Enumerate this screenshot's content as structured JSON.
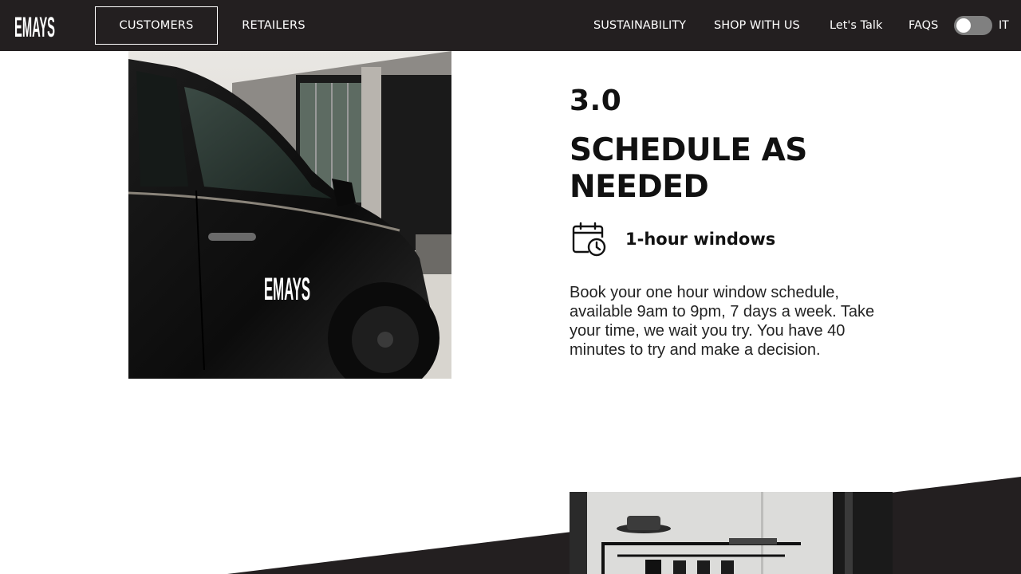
{
  "header": {
    "logo_text": "EMAYS",
    "nav_left": [
      {
        "label": "CUSTOMERS",
        "active": true
      },
      {
        "label": "RETAILERS",
        "active": false
      }
    ],
    "nav_right": [
      "SUSTAINABILITY",
      "SHOP WITH US",
      "Let's Talk",
      "FAQS"
    ],
    "language_toggle": {
      "label": "IT",
      "state": "off"
    }
  },
  "section": {
    "step_number": "3.0",
    "title": "SCHEDULE AS NEEDED",
    "feature": {
      "icon": "calendar-clock-icon",
      "label": "1-hour windows"
    },
    "description": "Book your one hour window schedule, available 9am to 9pm, 7 days a week. Take your time, we wait you try. You have 40 minutes to try and make a decision."
  },
  "images": {
    "car_photo_logo": "EMAYS"
  },
  "colors": {
    "header_bg": "#231f20",
    "accent_dark": "#231f20",
    "text": "#111111",
    "background": "#ffffff"
  }
}
